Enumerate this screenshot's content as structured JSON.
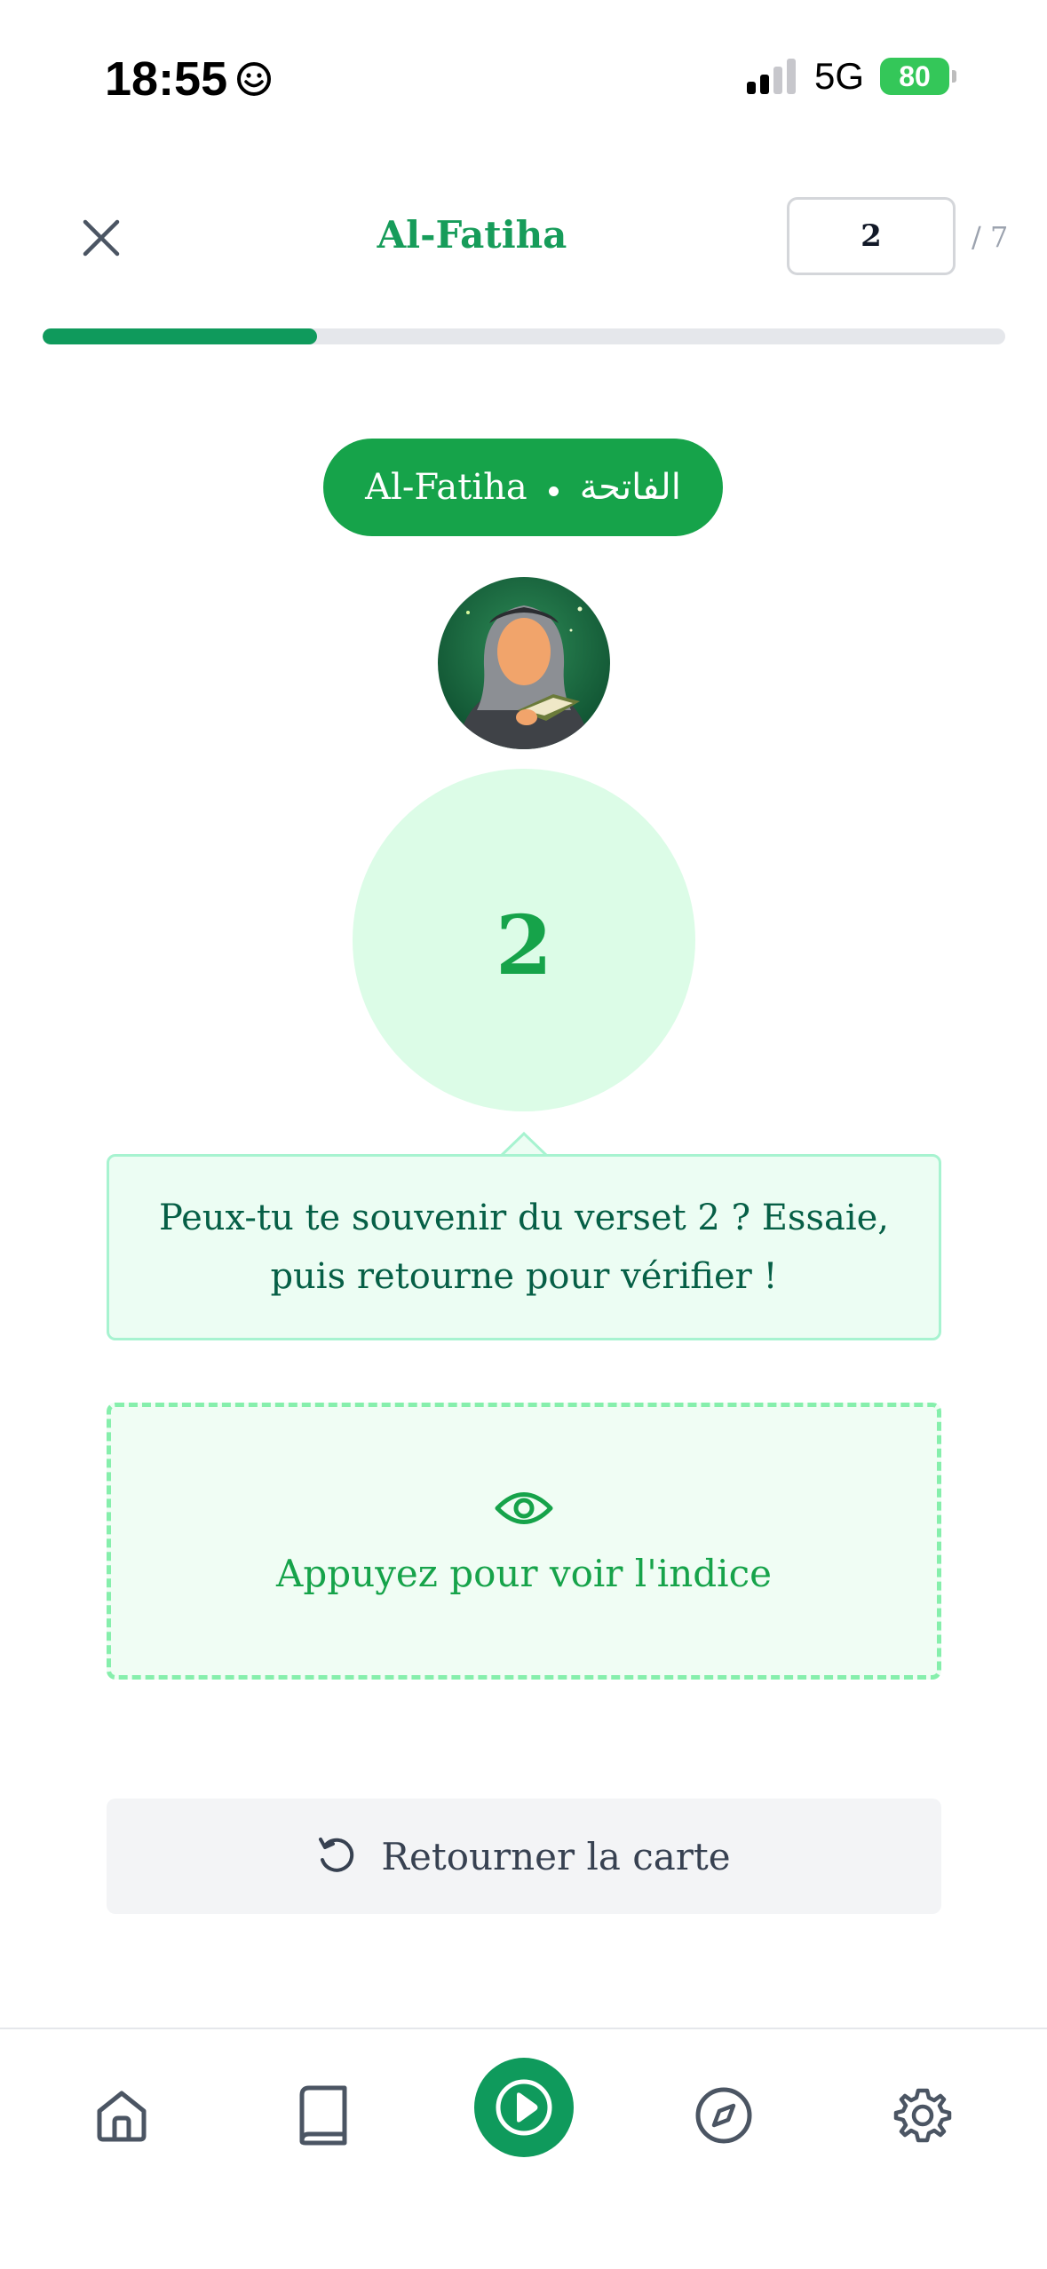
{
  "status_bar": {
    "time": "18:55",
    "network": "5G",
    "battery": "80"
  },
  "header": {
    "title": "Al-Fatiha",
    "verse_input_value": "2",
    "verse_total": "/ 7",
    "progress_fraction": 0.285
  },
  "surah_pill": {
    "latin": "Al-Fatiha",
    "arabic": "الفاتحة"
  },
  "card": {
    "verse_number": "2",
    "prompt": "Peux-tu te souvenir du verset 2 ? Essaie, puis retourne pour vérifier !",
    "hint_label": "Appuyez pour voir l'indice",
    "flip_label": "Retourner la carte"
  },
  "bottom_nav": {
    "items": [
      "home-icon",
      "book-icon",
      "play-icon",
      "compass-icon",
      "gear-icon"
    ]
  },
  "colors": {
    "primary_green": "#16a34a",
    "dark_green": "#0f9a5c",
    "light_green": "#dcfce7"
  }
}
